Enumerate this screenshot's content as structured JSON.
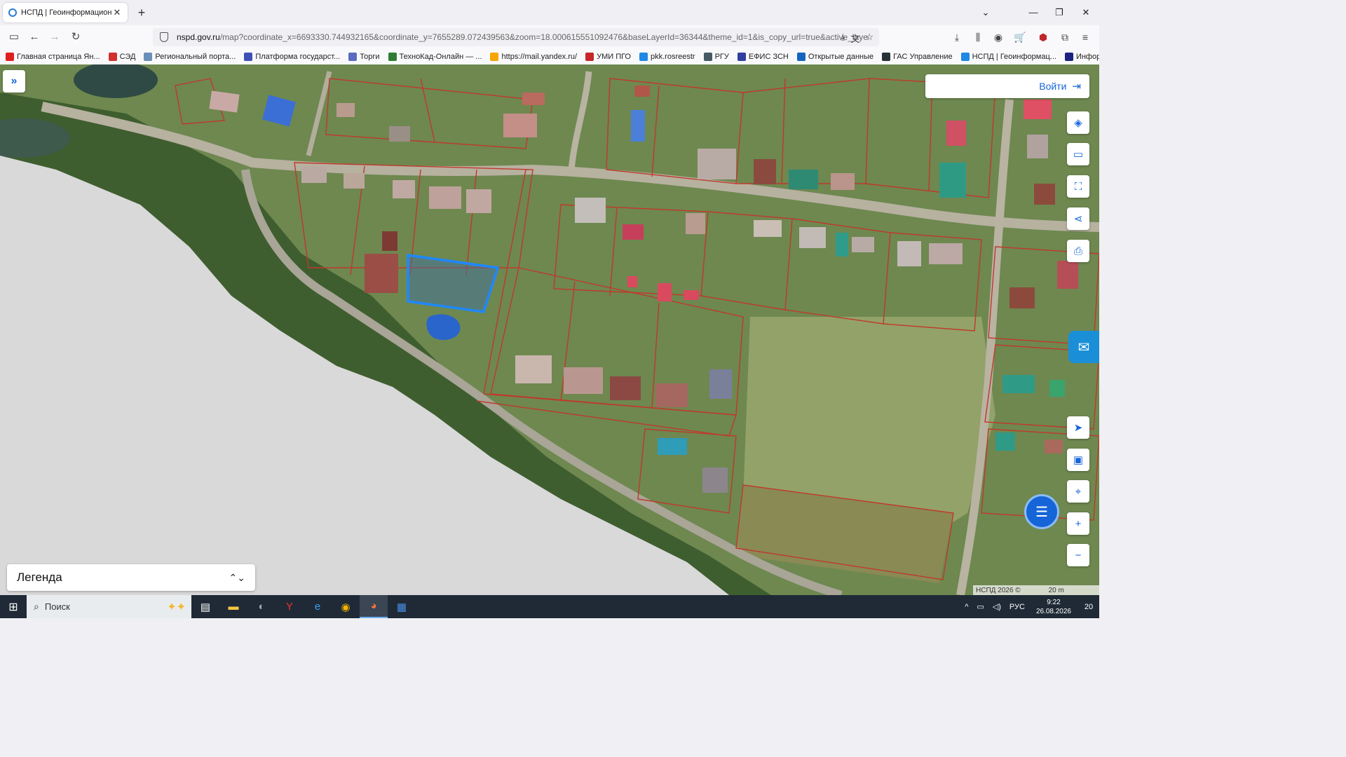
{
  "browser": {
    "tab_title": "НСПД | Геоинформационный",
    "new_tab": "+",
    "url_host": "nspd.gov.ru",
    "url_path": "/map?coordinate_x=6693330.744932165&coordinate_y=7655289.072439563&zoom=18.000615551092476&baseLayerId=36344&theme_id=1&is_copy_url=true&active_layers",
    "bookmarks": [
      {
        "label": "Главная страница Ян...",
        "color": "#e02020"
      },
      {
        "label": "СЭД",
        "color": "#d32f2f"
      },
      {
        "label": "Региональный порта...",
        "color": "#6a8fb8"
      },
      {
        "label": "Платформа государст...",
        "color": "#3f51b5"
      },
      {
        "label": "Торги",
        "color": "#5c6bc0"
      },
      {
        "label": "ТехноКад-Онлайн — ...",
        "color": "#2e7d32"
      },
      {
        "label": "https://mail.yandex.ru/",
        "color": "#f6a600"
      },
      {
        "label": "УМИ ПГО",
        "color": "#c62828"
      },
      {
        "label": "pkk.rosreestr",
        "color": "#1e88e5"
      },
      {
        "label": "РГУ",
        "color": "#455a64"
      },
      {
        "label": "ЕФИС ЗСН",
        "color": "#303f9f"
      },
      {
        "label": "Открытые данные",
        "color": "#1565c0"
      },
      {
        "label": "ГАС Управление",
        "color": "#263238"
      },
      {
        "label": "НСПД | Геоинформац...",
        "color": "#1e88e5"
      },
      {
        "label": "Информация о граж...",
        "color": "#1a237e"
      }
    ]
  },
  "map": {
    "login_label": "Войти",
    "legend_label": "Легенда",
    "attribution": "НСПД 2026 ©",
    "scale_label": "20 m",
    "parcel_border_color": "#c0392b",
    "selected_parcel_color": "#1e88ff"
  },
  "taskbar": {
    "search_label": "Поиск",
    "lang": "РУС",
    "time": "9:22",
    "date": "26.08.2026",
    "notifications": "20"
  }
}
